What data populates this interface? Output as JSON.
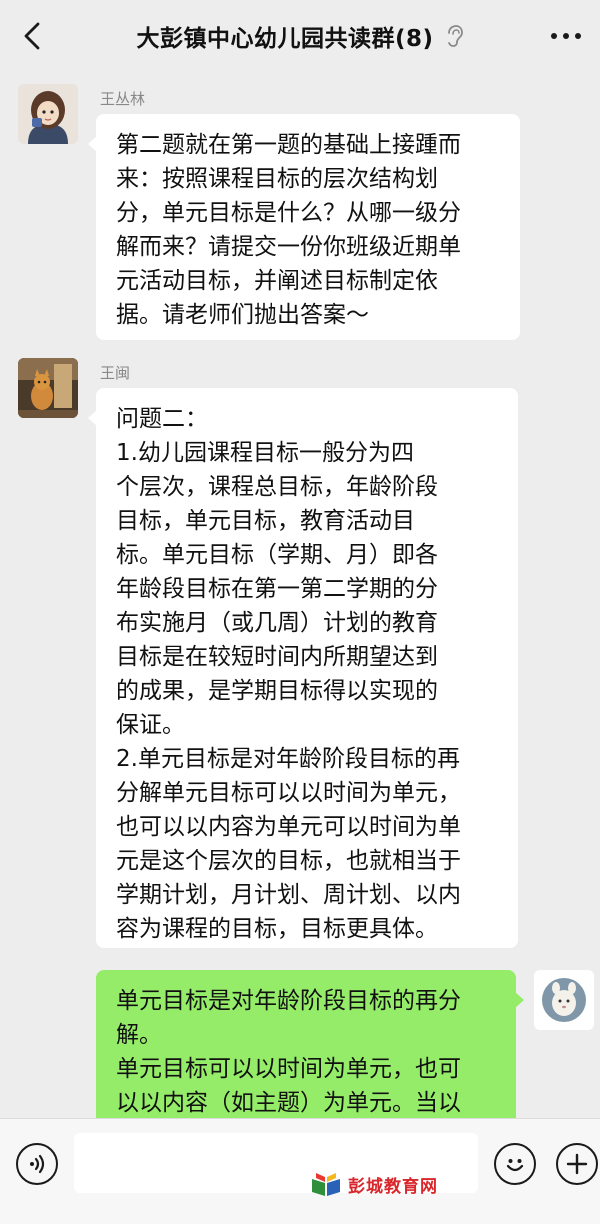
{
  "header": {
    "title": "大彭镇中心幼儿园共读群(8)",
    "back_icon": "chevron-left-icon",
    "ear_icon": "ear-icon",
    "more_icon": "more-dots-icon"
  },
  "messages": [
    {
      "sender": "王丛林",
      "direction": "incoming",
      "text": "第二题就在第一题的基础上接踵而\n来：按照课程目标的层次结构划\n分，单元目标是什么？从哪一级分\n解而来？请提交一份你班级近期单\n元活动目标，并阐述目标制定依\n据。请老师们抛出答案～"
    },
    {
      "sender": "王闽",
      "direction": "incoming",
      "text": "问题二：\n1.幼儿园课程目标一般分为四\n个层次，课程总目标，年龄阶段\n目标，单元目标，教育活动目\n标。单元目标（学期、月）即各\n年龄段目标在第一第二学期的分\n布实施月（或几周）计划的教育\n目标是在较短时间内所期望达到\n的成果，是学期目标得以实现的\n保证。\n2.单元目标是对年龄阶段目标的再\n分解单元目标可以以时间为单元，\n也可以以内容为单元可以时间为单\n元是这个层次的目标，也就相当于\n学期计划，月计划、周计划、以内\n容为课程的目标，目标更具体。"
    },
    {
      "sender": "",
      "direction": "outgoing",
      "text": "单元目标是对年龄阶段目标的再分\n解。\n单元目标可以以时间为单元，也可\n以以内容（如主题）为单元。当以"
    }
  ],
  "bottom_bar": {
    "voice_icon": "voice-icon",
    "emoji_icon": "emoji-icon",
    "plus_icon": "plus-icon",
    "watermark_text": "彭城教育网"
  },
  "colors": {
    "background": "#ededed",
    "outgoing_bubble": "#95ec69",
    "incoming_bubble": "#ffffff",
    "watermark": "#d9262b"
  }
}
